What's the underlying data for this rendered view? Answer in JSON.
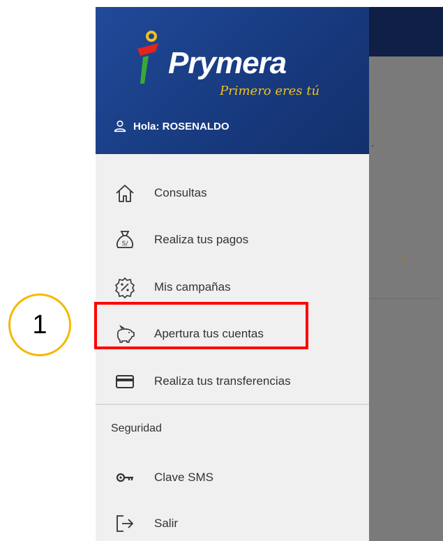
{
  "background": {
    "dot": ".",
    "chevron": "›"
  },
  "header": {
    "brand": "Prymera",
    "tagline": "Primero eres tú",
    "greeting": "Hola: ROSENALDO"
  },
  "menu": {
    "items": [
      {
        "label": "Consultas",
        "icon": "home-icon"
      },
      {
        "label": "Realiza tus pagos",
        "icon": "money-bag-icon"
      },
      {
        "label": "Mis campañas",
        "icon": "discount-badge-icon"
      },
      {
        "label": "Apertura tus cuentas",
        "icon": "piggy-bank-icon"
      },
      {
        "label": "Realiza tus transferencias",
        "icon": "card-icon"
      }
    ],
    "section_title": "Seguridad",
    "security_items": [
      {
        "label": "Clave SMS",
        "icon": "key-icon"
      },
      {
        "label": "Salir",
        "icon": "logout-icon"
      }
    ]
  },
  "annotation": {
    "step_number": "1"
  },
  "colors": {
    "header_blue": "#17397d",
    "accent_yellow": "#f2c218",
    "highlight_red": "#ff0000"
  }
}
